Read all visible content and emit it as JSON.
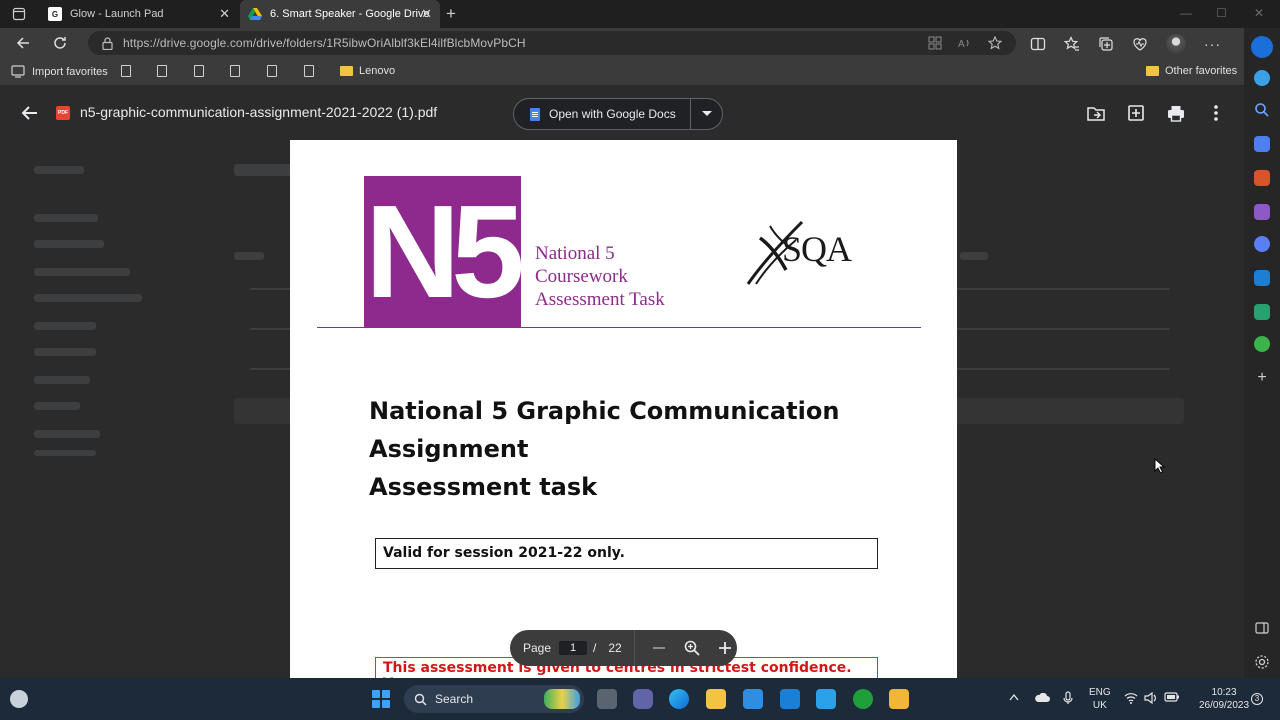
{
  "browser": {
    "tabs": [
      {
        "title": "Glow - Launch Pad",
        "active": false
      },
      {
        "title": "6. Smart Speaker - Google Drive",
        "active": true
      }
    ],
    "url": "https://drive.google.com/drive/folders/1R5ibwOriAlblf3kEl4ilfBlcbMovPbCH",
    "bookmarks": {
      "import_label": "Import favorites",
      "lenovo_label": "Lenovo",
      "other_label": "Other favorites"
    }
  },
  "viewer": {
    "file_name": "n5-graphic-communication-assignment-2021-2022 (1).pdf",
    "open_with_label": "Open with Google Docs",
    "pdf_badge": "PDF"
  },
  "pdf": {
    "logo_text": "N5",
    "logo_caption": [
      "National 5",
      "Coursework",
      "Assessment Task"
    ],
    "sqa_text": "SQA",
    "title_lines": [
      "National 5 Graphic Communication",
      "Assignment",
      "Assessment task"
    ],
    "valid_text": "Valid for session 2021-22 only.",
    "confidential_text": "This assessment is given to centres in strictest confidence. You"
  },
  "page_control": {
    "label": "Page",
    "current": "1",
    "separator": "/",
    "total": "22"
  },
  "taskbar": {
    "search_label": "Search",
    "lang_line1": "ENG",
    "lang_line2": "UK",
    "time": "10:23",
    "date": "26/09/2023",
    "notification_count": "3"
  },
  "colors": {
    "sqa_purple": "#8e2a8d",
    "confidential_red": "#d01818",
    "drive_bg": "#2b2b2b"
  }
}
